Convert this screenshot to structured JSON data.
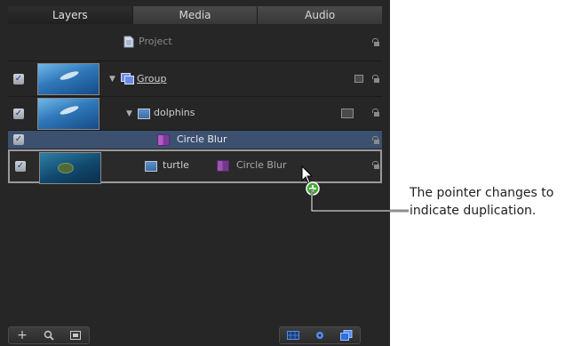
{
  "tabs": [
    "Layers",
    "Media",
    "Audio"
  ],
  "project": {
    "label": "Project"
  },
  "rows": {
    "group": {
      "label": "Group"
    },
    "dolphins": {
      "label": "dolphins"
    },
    "circle_blur": {
      "label": "Circle Blur"
    },
    "turtle": {
      "label": "turtle",
      "dragged_label": "Circle Blur"
    }
  },
  "bottom_toolbar": {
    "add_symbol": "+",
    "search_symbol": "⌕",
    "checkmark": "✓"
  },
  "callout": {
    "line1": "The pointer changes to",
    "line2": "indicate duplication."
  }
}
